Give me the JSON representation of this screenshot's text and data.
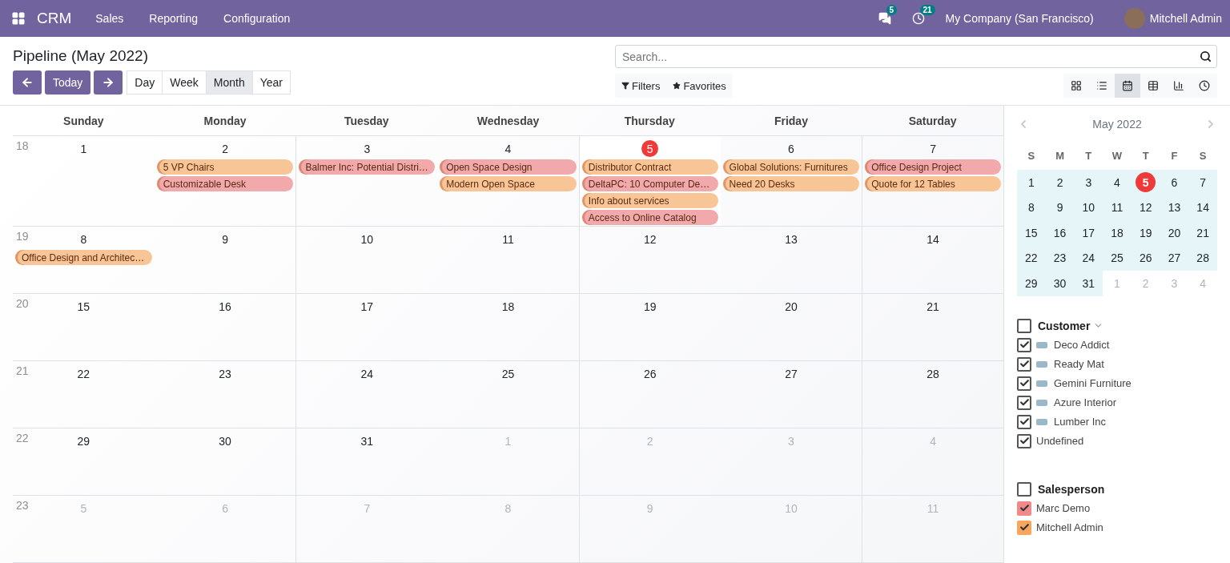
{
  "navbar": {
    "app_name": "CRM",
    "menus": [
      "Sales",
      "Reporting",
      "Configuration"
    ],
    "messages_count": "5",
    "activities_count": "21",
    "company": "My Company (San Francisco)",
    "user": "Mitchell Admin"
  },
  "title": "Pipeline (May 2022)",
  "search": {
    "placeholder": "Search..."
  },
  "nav_buttons": [
    {
      "kind": "prev"
    },
    {
      "kind": "today",
      "label": "Today"
    },
    {
      "kind": "next"
    }
  ],
  "scales": [
    {
      "label": "Day",
      "selected": false
    },
    {
      "label": "Week",
      "selected": false
    },
    {
      "label": "Month",
      "selected": true
    },
    {
      "label": "Year",
      "selected": false
    }
  ],
  "search_options": [
    {
      "kind": "filter",
      "label": "Filters"
    },
    {
      "kind": "star",
      "label": "Favorites"
    }
  ],
  "views": [
    {
      "kind": "kanban",
      "selected": false
    },
    {
      "kind": "list",
      "selected": false
    },
    {
      "kind": "calendar",
      "selected": true
    },
    {
      "kind": "pivot",
      "selected": false
    },
    {
      "kind": "graph",
      "selected": false
    },
    {
      "kind": "activity",
      "selected": false
    }
  ],
  "calendar": {
    "weekdays": [
      "Sunday",
      "Monday",
      "Tuesday",
      "Wednesday",
      "Thursday",
      "Friday",
      "Saturday"
    ],
    "weeks": [
      {
        "number": "18",
        "days": [
          {
            "day": "1",
            "other_month": false,
            "today": false
          },
          {
            "day": "2",
            "other_month": false,
            "today": false,
            "events": [
              {
                "title": "5 VP Chairs",
                "color": "#f8c596"
              },
              {
                "title": "Customizable Desk",
                "color": "#f1a9ac"
              }
            ]
          },
          {
            "day": "3",
            "other_month": false,
            "today": false,
            "events": [
              {
                "title": "Balmer Inc: Potential Distri…",
                "color": "#f1a9ac"
              }
            ]
          },
          {
            "day": "4",
            "other_month": false,
            "today": false,
            "events": [
              {
                "title": "Open Space Design",
                "color": "#f1a9ac"
              },
              {
                "title": "Modern Open Space",
                "color": "#f8c596"
              }
            ]
          },
          {
            "day": "5",
            "other_month": false,
            "today": true,
            "events": [
              {
                "title": "Distributor Contract",
                "color": "#f8c596"
              },
              {
                "title": "DeltaPC: 10 Computer De…",
                "color": "#f1a9ac"
              },
              {
                "title": "Info about services",
                "color": "#f8c596"
              },
              {
                "title": "Access to Online Catalog",
                "color": "#f1a9ac"
              }
            ]
          },
          {
            "day": "6",
            "other_month": false,
            "today": false,
            "events": [
              {
                "title": "Global Solutions: Furnitures",
                "color": "#f8c596"
              },
              {
                "title": "Need 20 Desks",
                "color": "#f8c596"
              }
            ]
          },
          {
            "day": "7",
            "other_month": false,
            "today": false,
            "events": [
              {
                "title": "Office Design Project",
                "color": "#f1a9ac"
              },
              {
                "title": "Quote for 12 Tables",
                "color": "#f8c596"
              }
            ]
          }
        ]
      },
      {
        "number": "19",
        "days": [
          {
            "day": "8",
            "other_month": false,
            "today": false,
            "events": [
              {
                "title": "Office Design and Architec…",
                "color": "#f8c596"
              }
            ]
          },
          {
            "day": "9",
            "other_month": false,
            "today": false
          },
          {
            "day": "10",
            "other_month": false,
            "today": false
          },
          {
            "day": "11",
            "other_month": false,
            "today": false
          },
          {
            "day": "12",
            "other_month": false,
            "today": false
          },
          {
            "day": "13",
            "other_month": false,
            "today": false
          },
          {
            "day": "14",
            "other_month": false,
            "today": false
          }
        ]
      },
      {
        "number": "20",
        "days": [
          {
            "day": "15",
            "other_month": false,
            "today": false
          },
          {
            "day": "16",
            "other_month": false,
            "today": false
          },
          {
            "day": "17",
            "other_month": false,
            "today": false
          },
          {
            "day": "18",
            "other_month": false,
            "today": false
          },
          {
            "day": "19",
            "other_month": false,
            "today": false
          },
          {
            "day": "20",
            "other_month": false,
            "today": false
          },
          {
            "day": "21",
            "other_month": false,
            "today": false
          }
        ]
      },
      {
        "number": "21",
        "days": [
          {
            "day": "22",
            "other_month": false,
            "today": false
          },
          {
            "day": "23",
            "other_month": false,
            "today": false
          },
          {
            "day": "24",
            "other_month": false,
            "today": false
          },
          {
            "day": "25",
            "other_month": false,
            "today": false
          },
          {
            "day": "26",
            "other_month": false,
            "today": false
          },
          {
            "day": "27",
            "other_month": false,
            "today": false
          },
          {
            "day": "28",
            "other_month": false,
            "today": false
          }
        ]
      },
      {
        "number": "22",
        "days": [
          {
            "day": "29",
            "other_month": false,
            "today": false
          },
          {
            "day": "30",
            "other_month": false,
            "today": false
          },
          {
            "day": "31",
            "other_month": false,
            "today": false
          },
          {
            "day": "1",
            "other_month": true,
            "today": false
          },
          {
            "day": "2",
            "other_month": true,
            "today": false
          },
          {
            "day": "3",
            "other_month": true,
            "today": false
          },
          {
            "day": "4",
            "other_month": true,
            "today": false
          }
        ]
      },
      {
        "number": "23",
        "days": [
          {
            "day": "5",
            "other_month": true,
            "today": false
          },
          {
            "day": "6",
            "other_month": true,
            "today": false
          },
          {
            "day": "7",
            "other_month": true,
            "today": false
          },
          {
            "day": "8",
            "other_month": true,
            "today": false
          },
          {
            "day": "9",
            "other_month": true,
            "today": false
          },
          {
            "day": "10",
            "other_month": true,
            "today": false
          },
          {
            "day": "11",
            "other_month": true,
            "today": false
          }
        ]
      }
    ]
  },
  "mini_calendar": {
    "title": "May 2022",
    "weekdays": [
      "S",
      "M",
      "T",
      "W",
      "T",
      "F",
      "S"
    ],
    "weeks": [
      [
        {
          "day": "1",
          "in_month": true,
          "today": false
        },
        {
          "day": "2",
          "in_month": true,
          "today": false
        },
        {
          "day": "3",
          "in_month": true,
          "today": false
        },
        {
          "day": "4",
          "in_month": true,
          "today": false
        },
        {
          "day": "5",
          "in_month": true,
          "today": true
        },
        {
          "day": "6",
          "in_month": true,
          "today": false
        },
        {
          "day": "7",
          "in_month": true,
          "today": false
        }
      ],
      [
        {
          "day": "8",
          "in_month": true,
          "today": false
        },
        {
          "day": "9",
          "in_month": true,
          "today": false
        },
        {
          "day": "10",
          "in_month": true,
          "today": false
        },
        {
          "day": "11",
          "in_month": true,
          "today": false
        },
        {
          "day": "12",
          "in_month": true,
          "today": false
        },
        {
          "day": "13",
          "in_month": true,
          "today": false
        },
        {
          "day": "14",
          "in_month": true,
          "today": false
        }
      ],
      [
        {
          "day": "15",
          "in_month": true,
          "today": false
        },
        {
          "day": "16",
          "in_month": true,
          "today": false
        },
        {
          "day": "17",
          "in_month": true,
          "today": false
        },
        {
          "day": "18",
          "in_month": true,
          "today": false
        },
        {
          "day": "19",
          "in_month": true,
          "today": false
        },
        {
          "day": "20",
          "in_month": true,
          "today": false
        },
        {
          "day": "21",
          "in_month": true,
          "today": false
        }
      ],
      [
        {
          "day": "22",
          "in_month": true,
          "today": false
        },
        {
          "day": "23",
          "in_month": true,
          "today": false
        },
        {
          "day": "24",
          "in_month": true,
          "today": false
        },
        {
          "day": "25",
          "in_month": true,
          "today": false
        },
        {
          "day": "26",
          "in_month": true,
          "today": false
        },
        {
          "day": "27",
          "in_month": true,
          "today": false
        },
        {
          "day": "28",
          "in_month": true,
          "today": false
        }
      ],
      [
        {
          "day": "29",
          "in_month": true,
          "today": false
        },
        {
          "day": "30",
          "in_month": true,
          "today": false
        },
        {
          "day": "31",
          "in_month": true,
          "today": false
        },
        {
          "day": "1",
          "in_month": false,
          "today": false
        },
        {
          "day": "2",
          "in_month": false,
          "today": false
        },
        {
          "day": "3",
          "in_month": false,
          "today": false
        },
        {
          "day": "4",
          "in_month": false,
          "today": false
        }
      ]
    ]
  },
  "filters": [
    {
      "title": "Customer",
      "checked": false,
      "collapsible": true,
      "items": [
        {
          "label": "Deco Addict",
          "checked": true,
          "kind": "logo"
        },
        {
          "label": "Ready Mat",
          "checked": true,
          "kind": "logo"
        },
        {
          "label": "Gemini Furniture",
          "checked": true,
          "kind": "logo"
        },
        {
          "label": "Azure Interior",
          "checked": true,
          "kind": "logo"
        },
        {
          "label": "Lumber Inc",
          "checked": true,
          "kind": "logo"
        },
        {
          "label": "Undefined",
          "checked": true,
          "kind": "plain"
        }
      ]
    },
    {
      "title": "Salesperson",
      "checked": false,
      "collapsible": false,
      "items": [
        {
          "label": "Marc Demo",
          "checked": true,
          "kind": "colored",
          "color": "#f08a8a"
        },
        {
          "label": "Mitchell Admin",
          "checked": true,
          "kind": "colored",
          "color": "#f6a65e"
        }
      ]
    }
  ]
}
